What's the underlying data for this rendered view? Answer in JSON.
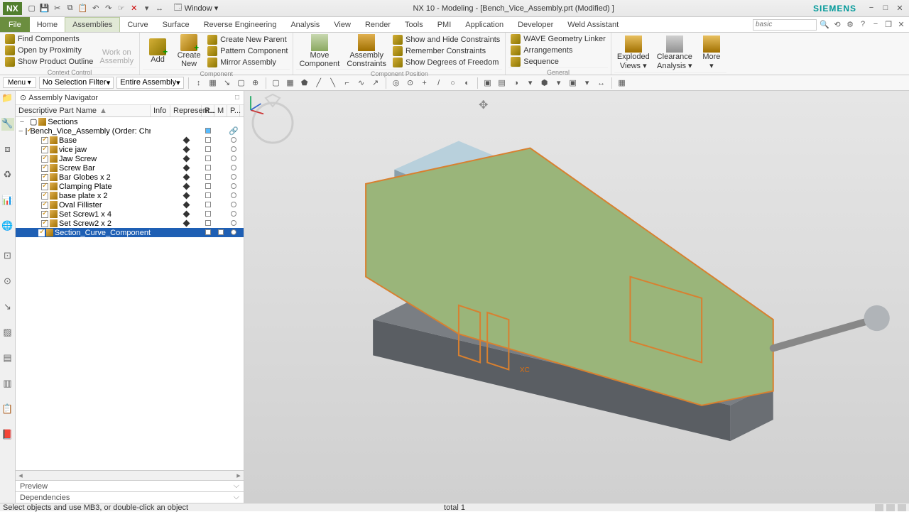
{
  "titlebar": {
    "app": "NX",
    "window_menu": "Window",
    "title": "NX 10 - Modeling - [Bench_Vice_Assembly.prt (Modified) ]",
    "brand": "SIEMENS"
  },
  "menubar": {
    "file": "File",
    "tabs": [
      "Home",
      "Assemblies",
      "Curve",
      "Surface",
      "Reverse Engineering",
      "Analysis",
      "View",
      "Render",
      "Tools",
      "PMI",
      "Application",
      "Developer",
      "Weld Assistant"
    ],
    "active_index": 1,
    "search_placeholder": "basic"
  },
  "ribbon": {
    "groups": [
      {
        "title": "Context Control",
        "small": [
          "Find Components",
          "Open by Proximity",
          "Show Product Outline"
        ],
        "large": [
          {
            "label": "Work on\nAssembly",
            "dim": true
          }
        ]
      },
      {
        "title": "Component",
        "large": [
          {
            "label": "Add"
          },
          {
            "label": "Create\nNew"
          }
        ],
        "small": [
          "Create New Parent",
          "Pattern Component",
          "Mirror Assembly"
        ]
      },
      {
        "title": "Component Position",
        "large": [
          {
            "label": "Move\nComponent"
          },
          {
            "label": "Assembly\nConstraints"
          }
        ],
        "small": [
          "Show and Hide Constraints",
          "Remember Constraints",
          "Show Degrees of Freedom"
        ]
      },
      {
        "title": "General",
        "small": [
          "WAVE Geometry Linker",
          "Arrangements",
          "Sequence"
        ]
      },
      {
        "title": "",
        "large": [
          {
            "label": "Exploded\nViews ▾"
          },
          {
            "label": "Clearance\nAnalysis ▾"
          },
          {
            "label": "More\n▾"
          }
        ]
      }
    ]
  },
  "toolbar2": {
    "menu": "Menu ▾",
    "filter": "No Selection Filter",
    "scope": "Entire Assembly"
  },
  "navigator": {
    "title": "Assembly Navigator",
    "headers": {
      "name": "Descriptive Part Name",
      "info": "Info",
      "rep": "Represent...",
      "r": "R..",
      "m": "M",
      "p": "P..."
    },
    "sections_label": "Sections",
    "root_label": "Bench_Vice_Assembly (Order: Chronolo...",
    "items": [
      {
        "label": "Base"
      },
      {
        "label": "vice jaw"
      },
      {
        "label": "Jaw Screw"
      },
      {
        "label": "Screw Bar"
      },
      {
        "label": "Bar Globes x 2"
      },
      {
        "label": "Clamping Plate"
      },
      {
        "label": "base plate x 2"
      },
      {
        "label": "Oval Fillister"
      },
      {
        "label": "Set Screw1 x 4"
      },
      {
        "label": "Set Screw2 x 2"
      }
    ],
    "selected_label": "Section_Curve_Component",
    "preview": "Preview",
    "dependencies": "Dependencies"
  },
  "viewport": {
    "axis_label": "XC"
  },
  "statusbar": {
    "hint": "Select objects and use MB3, or double-click an object",
    "center": "total 1"
  }
}
